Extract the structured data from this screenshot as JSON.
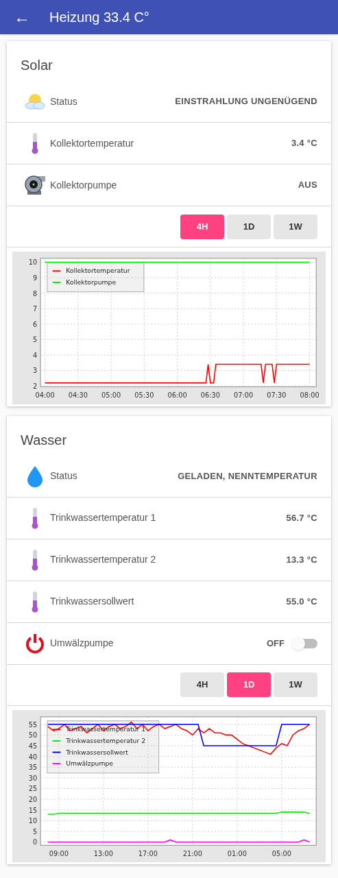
{
  "app_bar": {
    "back_icon": "←",
    "title": "Heizung 33.4 C°"
  },
  "cards": [
    {
      "title": "Solar",
      "rows": [
        {
          "kind": "value",
          "label": "Status",
          "value": "EINSTRAHLUNG UNGENÜGEND"
        },
        {
          "kind": "value",
          "label": "Kollektortemperatur",
          "value": "3.4 °C"
        },
        {
          "kind": "value",
          "label": "Kollektorpumpe",
          "value": "AUS"
        }
      ],
      "range_buttons": [
        {
          "label": "4H",
          "selected": true
        },
        {
          "label": "1D",
          "selected": false
        },
        {
          "label": "1W",
          "selected": false
        }
      ],
      "chart_data": {
        "type": "line",
        "grid": true,
        "legend": true,
        "x": [
          4,
          6.433,
          6.467,
          6.5,
          6.55,
          6.583,
          7.267,
          7.3,
          7.333,
          7.433,
          7.467,
          7.5,
          8
        ],
        "xlim": [
          3.933,
          8.1
        ],
        "ylim": [
          1.95,
          10.25
        ],
        "xticks": [
          {
            "value": 4,
            "label": "04:00"
          },
          {
            "value": 4.5,
            "label": "04:30"
          },
          {
            "value": 5,
            "label": "05:00"
          },
          {
            "value": 5.5,
            "label": "05:30"
          },
          {
            "value": 6,
            "label": "06:00"
          },
          {
            "value": 6.5,
            "label": "06:30"
          },
          {
            "value": 7,
            "label": "07:00"
          },
          {
            "value": 7.5,
            "label": "07:30"
          },
          {
            "value": 8,
            "label": "08:00"
          }
        ],
        "yticks": [
          2,
          3,
          4,
          5,
          6,
          7,
          8,
          9,
          10
        ],
        "series": [
          {
            "name": "Kollektortemperatur",
            "color": "#ff0000",
            "values": [
              2.2,
              2.2,
              3.4,
              2.2,
              2.2,
              3.4,
              3.4,
              2.2,
              3.4,
              3.4,
              2.2,
              3.4,
              3.4
            ]
          },
          {
            "name": "Kollektorpumpe",
            "color": "#00ee00",
            "values": [
              10,
              10,
              10,
              10,
              10,
              10,
              10,
              10,
              10,
              10,
              10,
              10,
              10
            ]
          }
        ]
      }
    },
    {
      "title": "Wasser",
      "rows": [
        {
          "kind": "value",
          "label": "Status",
          "value": "GELADEN, NENNTEMPERATUR"
        },
        {
          "kind": "value",
          "label": "Trinkwassertemperatur 1",
          "value": "56.7 °C"
        },
        {
          "kind": "value",
          "label": "Trinkwassertemperatur 2",
          "value": "13.3 °C"
        },
        {
          "kind": "value",
          "label": "Trinkwassersollwert",
          "value": "55.0 °C"
        },
        {
          "kind": "switch",
          "label": "Umwälzpumpe",
          "value": "OFF",
          "on": false
        }
      ],
      "range_buttons": [
        {
          "label": "4H",
          "selected": false
        },
        {
          "label": "1D",
          "selected": true
        },
        {
          "label": "1W",
          "selected": false
        }
      ],
      "chart_data": {
        "type": "line",
        "grid": true,
        "legend": true,
        "categories": [
          null,
          null,
          "09:00",
          null,
          null,
          null,
          null,
          null,
          null,
          null,
          "13:00",
          null,
          null,
          null,
          null,
          null,
          null,
          null,
          "17:00",
          null,
          null,
          null,
          null,
          null,
          null,
          null,
          "21:00",
          null,
          null,
          null,
          null,
          null,
          null,
          null,
          "01:00",
          null,
          null,
          null,
          null,
          null,
          null,
          null,
          "05:00",
          null,
          null,
          null,
          null,
          null
        ],
        "ylim": [
          -1.5,
          58.5
        ],
        "yticks": [
          0,
          5,
          10,
          15,
          20,
          25,
          30,
          35,
          40,
          45,
          50,
          55
        ],
        "series": [
          {
            "name": "Trinkwassertemperatur 1",
            "color": "#ff0000",
            "values": [
              54,
              52,
              53,
              55,
              52,
              53,
              54,
              51,
              53,
              55,
              52,
              54,
              55,
              53,
              54,
              56,
              53,
              55,
              52,
              54,
              55,
              53,
              54,
              55,
              53,
              52,
              50,
              53,
              51,
              53,
              51,
              51,
              50,
              50,
              48,
              46,
              45,
              44,
              43,
              42,
              41,
              44,
              46,
              45,
              50,
              52,
              53,
              55
            ]
          },
          {
            "name": "Trinkwassertemperatur 2",
            "color": "#00ee00",
            "values": [
              13,
              13,
              13.5,
              13.5,
              13.5,
              13.5,
              13.5,
              13.5,
              13.5,
              13.5,
              13.5,
              13.5,
              13.5,
              13.5,
              13.5,
              13.5,
              13.5,
              13.5,
              13.5,
              13.5,
              13.5,
              13.5,
              13.5,
              13.5,
              13.5,
              13.5,
              13.5,
              13.5,
              13.5,
              13.5,
              13.5,
              13.5,
              13.5,
              13.5,
              13.5,
              13.5,
              13.5,
              13.5,
              13.5,
              13.5,
              13.5,
              13.5,
              14,
              14,
              14,
              14,
              14,
              13.3
            ]
          },
          {
            "name": "Trinkwassersollwert",
            "color": "#0000ff",
            "values": [
              55,
              55,
              55,
              55,
              55,
              55,
              55,
              55,
              55,
              55,
              55,
              55,
              55,
              55,
              55,
              55,
              55,
              55,
              55,
              55,
              55,
              55,
              55,
              55,
              55,
              55,
              55,
              55,
              45,
              45,
              45,
              45,
              45,
              45,
              45,
              45,
              45,
              45,
              45,
              45,
              45,
              45,
              55,
              55,
              55,
              55,
              55,
              55
            ]
          },
          {
            "name": "Umwälzpumpe",
            "color": "#ff00ff",
            "values": [
              0,
              0,
              0,
              0,
              0,
              0,
              0,
              0,
              0,
              0,
              0,
              0,
              0,
              0,
              0,
              0,
              0,
              0,
              0,
              0,
              0,
              0,
              1,
              0,
              0,
              0,
              0,
              0,
              0,
              0,
              0,
              0,
              0,
              0,
              0,
              0,
              0,
              0,
              0,
              0,
              0,
              0,
              0,
              0,
              0,
              0,
              1,
              0
            ]
          }
        ]
      }
    }
  ]
}
